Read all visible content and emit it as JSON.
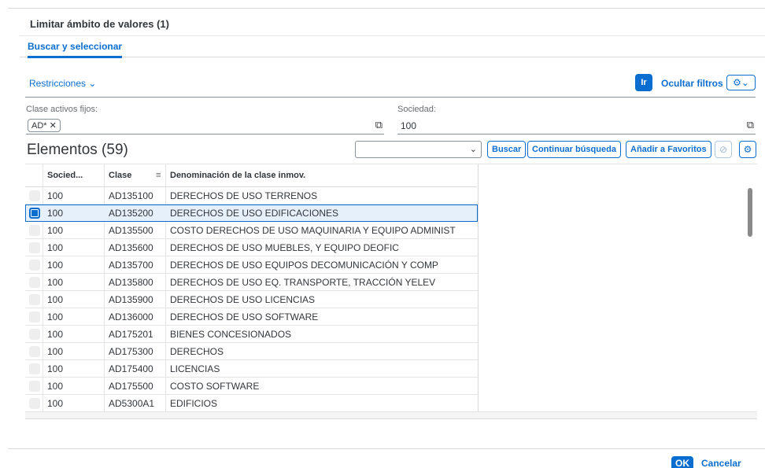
{
  "dialog": {
    "title": "Limitar ámbito de valores (1)"
  },
  "tabs": [
    {
      "label": "Buscar y seleccionar"
    }
  ],
  "filterbar": {
    "restrictions_label": "Restricciones",
    "go_label": "Ir",
    "hide_filters_label": "Ocultar filtros",
    "fields": [
      {
        "label": "Clase activos fijos:",
        "token": "AD*"
      },
      {
        "label": "Sociedad:",
        "value": "100"
      }
    ]
  },
  "toolbar": {
    "title": "Elementos (59)",
    "select_value": "",
    "search_label": "Buscar",
    "continue_label": "Continuar búsqueda",
    "favorites_label": "Añadir a Favoritos"
  },
  "table": {
    "columns": [
      "Socied...",
      "Clase",
      "Denominación de la clase inmov."
    ],
    "selected_index": 1,
    "rows": [
      [
        "100",
        "AD135100",
        "DERECHOS DE USO TERRENOS"
      ],
      [
        "100",
        "AD135200",
        "DERECHOS DE USO EDIFICACIONES"
      ],
      [
        "100",
        "AD135500",
        "COSTO DERECHOS DE USO MAQUINARIA Y EQUIPO ADMINIST"
      ],
      [
        "100",
        "AD135600",
        "DERECHOS DE USO  MUEBLES, Y EQUIPO DEOFIC"
      ],
      [
        "100",
        "AD135700",
        "DERECHOS DE USO EQUIPOS DECOMUNICACIÓN Y COMP"
      ],
      [
        "100",
        "AD135800",
        "DERECHOS DE USO  EQ. TRANSPORTE, TRACCIÓN YELEV"
      ],
      [
        "100",
        "AD135900",
        "DERECHOS DE USO LICENCIAS"
      ],
      [
        "100",
        "AD136000",
        "DERECHOS DE USO SOFTWARE"
      ],
      [
        "100",
        "AD175201",
        "BIENES CONCESIONADOS"
      ],
      [
        "100",
        "AD175300",
        "DERECHOS"
      ],
      [
        "100",
        "AD175400",
        "LICENCIAS"
      ],
      [
        "100",
        "AD175500",
        "COSTO SOFTWARE"
      ],
      [
        "100",
        "AD5300A1",
        "EDIFICIOS"
      ]
    ]
  },
  "footer": {
    "ok_label": "OK",
    "cancel_label": "Cancelar"
  },
  "colors": {
    "accent": "#0a6ed1"
  },
  "icons": [
    "chevron-down-icon",
    "settings-icon",
    "value-help-icon",
    "close-icon",
    "sort-icon",
    "disabled-icon"
  ]
}
